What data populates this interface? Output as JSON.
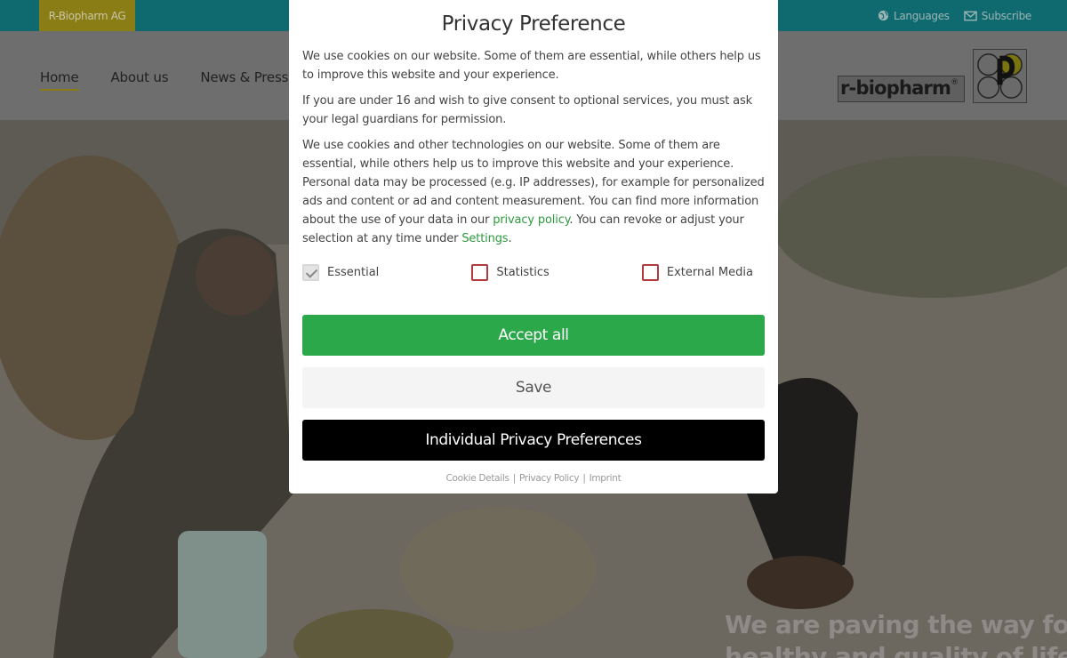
{
  "topbar": {
    "brand": "R-Biopharm AG",
    "languages": "Languages",
    "subscribe": "Subscribe",
    "languages_icon": "globe-icon",
    "subscribe_icon": "envelope-icon"
  },
  "header": {
    "nav": [
      "Home",
      "About us",
      "News & Press"
    ],
    "logo_text": "r-biopharm",
    "logo_reg": "®"
  },
  "hero": {
    "headline_line1": "We are paving the way for",
    "headline_line2": "healthy and quality of life"
  },
  "modal": {
    "title": "Privacy Preference",
    "para1": "We use cookies on our website. Some of them are essential, while others help us to improve this website and your experience.",
    "para2": "If you are under 16 and wish to give consent to optional services, you must ask your legal guardians for permission.",
    "para3_a": "We use cookies and other technologies on our website. Some of them are essential, while others help us to improve this website and your experience. Personal data may be processed (e.g. IP addresses), for example for personalized ads and content or ad and content measurement. You can find more information about the use of your data in our ",
    "para3_link1": "privacy policy",
    "para3_b": ". You can revoke or adjust your selection at any time under ",
    "para3_link2": "Settings",
    "para3_c": ".",
    "consents": [
      {
        "label": "Essential",
        "checked": true
      },
      {
        "label": "Statistics",
        "checked": false
      },
      {
        "label": "External Media",
        "checked": false
      }
    ],
    "accept_all": "Accept all",
    "save": "Save",
    "individual": "Individual Privacy Preferences",
    "footer_links": [
      "Cookie Details",
      "Privacy Policy",
      "Imprint"
    ],
    "footer_sep": "|"
  },
  "colors": {
    "accept": "#2ba84a",
    "link": "#2d9a3e",
    "topbar": "#0f6a6f",
    "brand_tab": "#8a7d15"
  }
}
